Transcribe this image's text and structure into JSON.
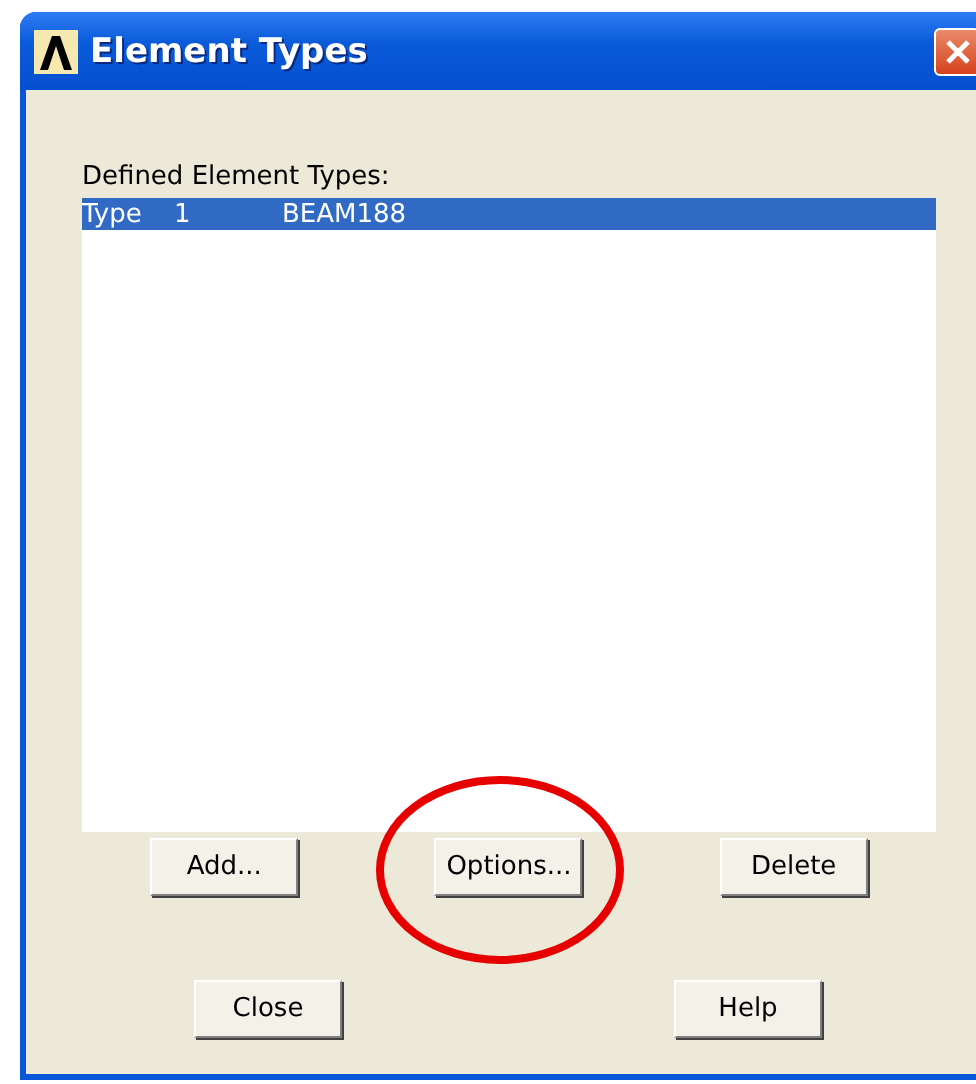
{
  "window": {
    "title": "Element Types"
  },
  "list": {
    "label": "Defined Element Types:",
    "rows": [
      {
        "cells": [
          "Type",
          "1",
          "BEAM188"
        ],
        "selected": true
      }
    ]
  },
  "action_buttons": [
    {
      "label": "Add...",
      "highlighted": false
    },
    {
      "label": "Options...",
      "highlighted": true
    },
    {
      "label": "Delete",
      "highlighted": false
    }
  ],
  "footer_buttons": [
    {
      "label": "Close"
    },
    {
      "label": "Help"
    }
  ]
}
